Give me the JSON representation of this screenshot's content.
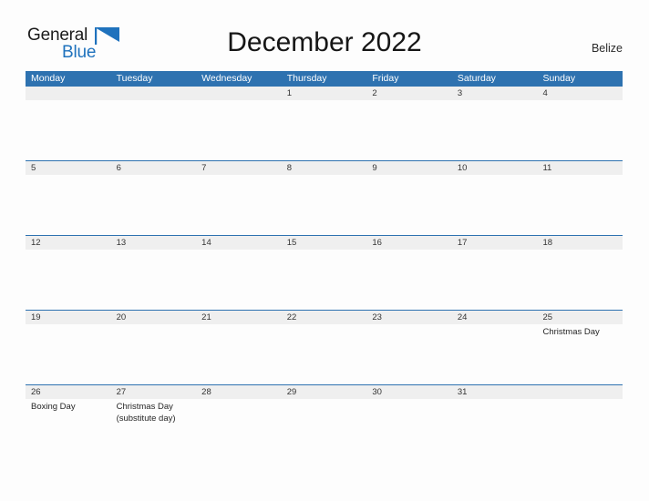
{
  "brand": {
    "name_part1": "General",
    "name_part2": "Blue",
    "flag_icon": "blue-flag-triangle"
  },
  "header": {
    "title": "December 2022",
    "region": "Belize"
  },
  "colors": {
    "header_blue": "#2e72b0",
    "date_band_gray": "#efefef",
    "brand_blue": "#1f72bd",
    "page_background": "#fdfdfd"
  },
  "calendar": {
    "weekdays": [
      "Monday",
      "Tuesday",
      "Wednesday",
      "Thursday",
      "Friday",
      "Saturday",
      "Sunday"
    ],
    "weeks": [
      {
        "days": [
          {
            "num": "",
            "event": ""
          },
          {
            "num": "",
            "event": ""
          },
          {
            "num": "",
            "event": ""
          },
          {
            "num": "1",
            "event": ""
          },
          {
            "num": "2",
            "event": ""
          },
          {
            "num": "3",
            "event": ""
          },
          {
            "num": "4",
            "event": ""
          }
        ]
      },
      {
        "days": [
          {
            "num": "5",
            "event": ""
          },
          {
            "num": "6",
            "event": ""
          },
          {
            "num": "7",
            "event": ""
          },
          {
            "num": "8",
            "event": ""
          },
          {
            "num": "9",
            "event": ""
          },
          {
            "num": "10",
            "event": ""
          },
          {
            "num": "11",
            "event": ""
          }
        ]
      },
      {
        "days": [
          {
            "num": "12",
            "event": ""
          },
          {
            "num": "13",
            "event": ""
          },
          {
            "num": "14",
            "event": ""
          },
          {
            "num": "15",
            "event": ""
          },
          {
            "num": "16",
            "event": ""
          },
          {
            "num": "17",
            "event": ""
          },
          {
            "num": "18",
            "event": ""
          }
        ]
      },
      {
        "days": [
          {
            "num": "19",
            "event": ""
          },
          {
            "num": "20",
            "event": ""
          },
          {
            "num": "21",
            "event": ""
          },
          {
            "num": "22",
            "event": ""
          },
          {
            "num": "23",
            "event": ""
          },
          {
            "num": "24",
            "event": ""
          },
          {
            "num": "25",
            "event": "Christmas Day"
          }
        ]
      },
      {
        "days": [
          {
            "num": "26",
            "event": "Boxing Day"
          },
          {
            "num": "27",
            "event": "Christmas Day\n(substitute day)"
          },
          {
            "num": "28",
            "event": ""
          },
          {
            "num": "29",
            "event": ""
          },
          {
            "num": "30",
            "event": ""
          },
          {
            "num": "31",
            "event": ""
          },
          {
            "num": "",
            "event": ""
          }
        ]
      }
    ]
  }
}
